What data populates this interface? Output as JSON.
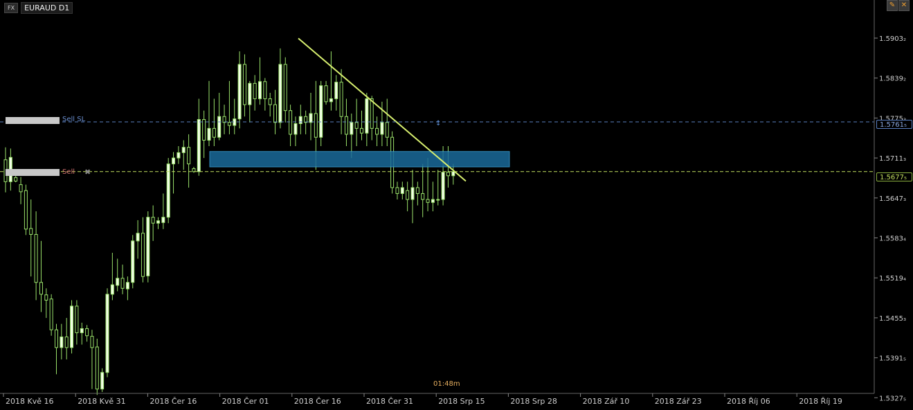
{
  "header": {
    "fx_badge": "FX",
    "symbol": "EURAUD D1",
    "pencil_icon": "pencil-icon",
    "close_icon": "close-icon"
  },
  "price_axis": {
    "labels": [
      "1.5903₂",
      "1.5839₂",
      "1.5775₃",
      "1.5711₃",
      "1.5647₃",
      "1.5583₄",
      "1.5519₄",
      "1.5455₃",
      "1.5391₅",
      "1.5327₅"
    ],
    "sl_price": "1.5761₅",
    "current_price": "1.5677₅"
  },
  "time_axis": {
    "labels": [
      "2018 Kvě 16",
      "2018 Kvě 31",
      "2018 Čer 16",
      "2018 Čer 01",
      "2018 Čer 16",
      "2018 Čer 31",
      "2018 Srp 15",
      "2018 Srp 28",
      "2018 Zář 10",
      "2018 Zář 23",
      "2018 Říj 06",
      "2018 Říj 19"
    ]
  },
  "orders": {
    "sl_label": "Sell  SL",
    "sell_label": "Sell",
    "sl_color": "#6a8fd0",
    "sell_color": "#d07070"
  },
  "timer": "01:48m",
  "colors": {
    "background": "#000000",
    "bull_body": "#f2ffe6",
    "wick": "#9be36b",
    "trendline": "#d8f070",
    "zone_fill": "#1a6a9a",
    "price_line": "#c4e060"
  },
  "chart_data": {
    "type": "candlestick",
    "symbol": "EURAUD",
    "timeframe": "D1",
    "ylim": [
      1.5305,
      1.5955
    ],
    "candles": [
      [
        1.5697,
        1.5718,
        1.5642,
        1.566
      ],
      [
        1.566,
        1.5716,
        1.5645,
        1.5701
      ],
      [
        1.5667,
        1.5676,
        1.5659,
        1.5661
      ],
      [
        1.5655,
        1.5668,
        1.5622,
        1.5643
      ],
      [
        1.5645,
        1.5655,
        1.557,
        1.558
      ],
      [
        1.5581,
        1.563,
        1.55,
        1.5571
      ],
      [
        1.5571,
        1.561,
        1.546,
        1.549
      ],
      [
        1.549,
        1.556,
        1.544,
        1.547
      ],
      [
        1.5469,
        1.548,
        1.543,
        1.546
      ],
      [
        1.5462,
        1.547,
        1.54,
        1.541
      ],
      [
        1.541,
        1.542,
        1.5335,
        1.538
      ],
      [
        1.538,
        1.542,
        1.536,
        1.5398
      ],
      [
        1.5398,
        1.543,
        1.536,
        1.538
      ],
      [
        1.538,
        1.546,
        1.537,
        1.545
      ],
      [
        1.545,
        1.546,
        1.5385,
        1.5405
      ],
      [
        1.5405,
        1.5422,
        1.5385,
        1.5412
      ],
      [
        1.5412,
        1.5418,
        1.539,
        1.54
      ],
      [
        1.5399,
        1.541,
        1.531,
        1.538
      ],
      [
        1.5381,
        1.5395,
        1.53,
        1.531
      ],
      [
        1.531,
        1.5345,
        1.5305,
        1.5338
      ],
      [
        1.5338,
        1.548,
        1.533,
        1.547
      ],
      [
        1.547,
        1.554,
        1.546,
        1.5486
      ],
      [
        1.5485,
        1.553,
        1.5475,
        1.5497
      ],
      [
        1.5497,
        1.552,
        1.547,
        1.548
      ],
      [
        1.5479,
        1.55,
        1.546,
        1.549
      ],
      [
        1.549,
        1.557,
        1.548,
        1.556
      ],
      [
        1.556,
        1.5595,
        1.553,
        1.5573
      ],
      [
        1.5573,
        1.56,
        1.549,
        1.55
      ],
      [
        1.5501,
        1.561,
        1.549,
        1.56
      ],
      [
        1.56,
        1.562,
        1.556,
        1.559
      ],
      [
        1.559,
        1.56,
        1.558,
        1.5594
      ],
      [
        1.5591,
        1.564,
        1.558,
        1.56
      ],
      [
        1.56,
        1.57,
        1.559,
        1.569
      ],
      [
        1.569,
        1.571,
        1.564,
        1.57
      ],
      [
        1.57,
        1.572,
        1.569,
        1.5709
      ],
      [
        1.5709,
        1.573,
        1.568,
        1.5718
      ],
      [
        1.5718,
        1.574,
        1.565,
        1.569
      ],
      [
        1.5682,
        1.5685,
        1.5675,
        1.5677
      ],
      [
        1.5677,
        1.58,
        1.567,
        1.5765
      ],
      [
        1.5765,
        1.578,
        1.57,
        1.573
      ],
      [
        1.573,
        1.583,
        1.572,
        1.575
      ],
      [
        1.575,
        1.58,
        1.572,
        1.5735
      ],
      [
        1.5735,
        1.581,
        1.573,
        1.577
      ],
      [
        1.577,
        1.579,
        1.574,
        1.576
      ],
      [
        1.576,
        1.583,
        1.574,
        1.5755
      ],
      [
        1.5755,
        1.58,
        1.574,
        1.5766
      ],
      [
        1.5766,
        1.588,
        1.575,
        1.5858
      ],
      [
        1.5858,
        1.5875,
        1.577,
        1.579
      ],
      [
        1.579,
        1.583,
        1.576,
        1.5826
      ],
      [
        1.5826,
        1.584,
        1.578,
        1.58
      ],
      [
        1.58,
        1.587,
        1.579,
        1.5829
      ],
      [
        1.5829,
        1.5835,
        1.578,
        1.58
      ],
      [
        1.58,
        1.581,
        1.577,
        1.579
      ],
      [
        1.579,
        1.5815,
        1.574,
        1.576
      ],
      [
        1.576,
        1.5885,
        1.575,
        1.5858
      ],
      [
        1.5858,
        1.587,
        1.576,
        1.578
      ],
      [
        1.578,
        1.579,
        1.572,
        1.574
      ],
      [
        1.574,
        1.577,
        1.572,
        1.5758
      ],
      [
        1.5758,
        1.579,
        1.574,
        1.577
      ],
      [
        1.577,
        1.578,
        1.574,
        1.576
      ],
      [
        1.576,
        1.581,
        1.573,
        1.5775
      ],
      [
        1.5775,
        1.583,
        1.568,
        1.5735
      ],
      [
        1.5735,
        1.583,
        1.572,
        1.5822
      ],
      [
        1.5822,
        1.583,
        1.579,
        1.5795
      ],
      [
        1.5795,
        1.588,
        1.578,
        1.58
      ],
      [
        1.58,
        1.584,
        1.578,
        1.5828
      ],
      [
        1.5828,
        1.585,
        1.574,
        1.577
      ],
      [
        1.577,
        1.58,
        1.572,
        1.574
      ],
      [
        1.574,
        1.5775,
        1.57,
        1.576
      ],
      [
        1.576,
        1.58,
        1.572,
        1.575
      ],
      [
        1.575,
        1.578,
        1.573,
        1.5742
      ],
      [
        1.5742,
        1.581,
        1.572,
        1.58
      ],
      [
        1.58,
        1.5805,
        1.573,
        1.575
      ],
      [
        1.575,
        1.577,
        1.572,
        1.574
      ],
      [
        1.574,
        1.5795,
        1.572,
        1.576
      ],
      [
        1.576,
        1.58,
        1.572,
        1.5735
      ],
      [
        1.5735,
        1.5745,
        1.564,
        1.565
      ],
      [
        1.565,
        1.566,
        1.563,
        1.564
      ],
      [
        1.564,
        1.566,
        1.563,
        1.565
      ],
      [
        1.5645,
        1.566,
        1.561,
        1.563
      ],
      [
        1.563,
        1.568,
        1.559,
        1.565
      ],
      [
        1.565,
        1.566,
        1.562,
        1.564
      ],
      [
        1.564,
        1.569,
        1.56,
        1.563
      ],
      [
        1.563,
        1.57,
        1.561,
        1.5625
      ],
      [
        1.5625,
        1.566,
        1.561,
        1.563
      ],
      [
        1.563,
        1.568,
        1.562,
        1.563
      ],
      [
        1.563,
        1.572,
        1.562,
        1.5676
      ],
      [
        1.5676,
        1.572,
        1.565,
        1.567
      ],
      [
        1.567,
        1.569,
        1.5655,
        1.5677
      ]
    ],
    "sell_sl_level": 1.5761,
    "sell_level": 1.5677,
    "zone": {
      "top": 1.5711,
      "bottom": 1.5685,
      "x_start": "2018 Čer 16",
      "x_end": "2018 Srp 15"
    },
    "trendline": {
      "from": [
        0.0,
        1.5902
      ],
      "to": [
        1.0,
        1.5661
      ]
    },
    "grid": false
  }
}
